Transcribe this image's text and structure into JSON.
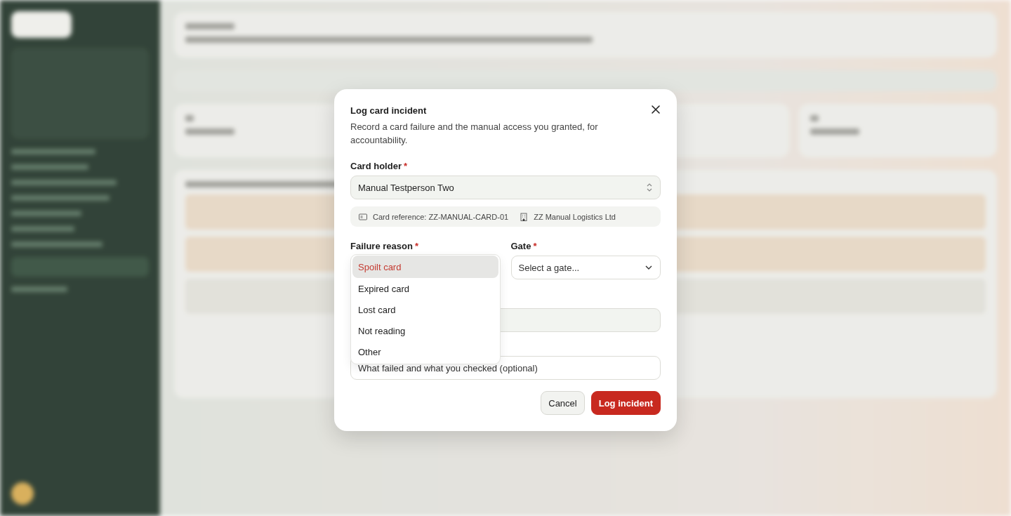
{
  "dialog": {
    "title": "Log card incident",
    "description": "Record a card failure and the manual access you granted, for accountability.",
    "card_holder": {
      "label": "Card holder",
      "mark": "*",
      "value": "Manual Testperson Two"
    },
    "card_info": {
      "reference": "Card reference: ZZ-MANUAL-CARD-01",
      "company": "ZZ Manual Logistics Ltd"
    },
    "failure_reason": {
      "label": "Failure reason",
      "mark": "*",
      "expanded": true,
      "options": [
        {
          "label": "Spoilt card",
          "selected": true
        },
        {
          "label": "Expired card",
          "selected": false
        },
        {
          "label": "Lost card",
          "selected": false
        },
        {
          "label": "Not reading",
          "selected": false
        },
        {
          "label": "Other",
          "selected": false
        }
      ]
    },
    "gate": {
      "label": "Gate",
      "mark": "*",
      "placeholder": "Select a gate..."
    },
    "notes": {
      "placeholder": "What failed and what you checked (optional)"
    },
    "buttons": [
      {
        "label": "Cancel",
        "kind": "secondary"
      },
      {
        "label": "Log incident",
        "kind": "primary"
      }
    ]
  }
}
